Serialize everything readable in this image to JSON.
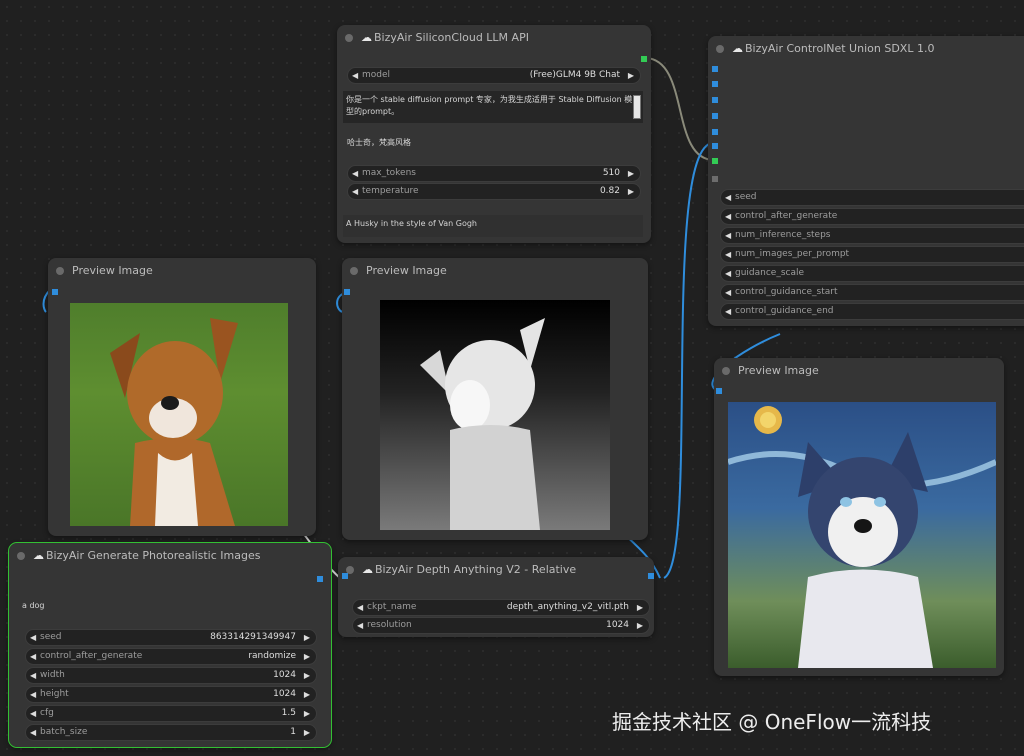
{
  "llm_node": {
    "title": "BizyAir SiliconCloud LLM API",
    "model_label": "model",
    "model_value": "(Free)GLM4 9B Chat",
    "system_prompt": "你是一个 stable diffusion prompt 专家，为我生成适用于 Stable Diffusion 模型的prompt。",
    "user_prompt": "哈士奇，梵高风格",
    "max_tokens_label": "max_tokens",
    "max_tokens_value": "510",
    "temperature_label": "temperature",
    "temperature_value": "0.82",
    "output_text": "A Husky in the style of Van Gogh"
  },
  "controlnet_node": {
    "title": "BizyAir ControlNet Union SDXL 1.0",
    "widgets": [
      "seed",
      "control_after_generate",
      "num_inference_steps",
      "num_images_per_prompt",
      "guidance_scale",
      "control_guidance_start",
      "control_guidance_end"
    ]
  },
  "preview1": {
    "title": "Preview Image"
  },
  "preview2": {
    "title": "Preview Image"
  },
  "preview3": {
    "title": "Preview Image"
  },
  "depth_node": {
    "title": "BizyAir Depth Anything V2 - Relative",
    "ckpt_label": "ckpt_name",
    "ckpt_value": "depth_anything_v2_vitl.pth",
    "resolution_label": "resolution",
    "resolution_value": "1024"
  },
  "generate_node": {
    "title": "BizyAir Generate Photorealistic Images",
    "prompt": "a dog",
    "seed_label": "seed",
    "seed_value": "863314291349947",
    "cag_label": "control_after_generate",
    "cag_value": "randomize",
    "width_label": "width",
    "width_value": "1024",
    "height_label": "height",
    "height_value": "1024",
    "cfg_label": "cfg",
    "cfg_value": "1.5",
    "batch_label": "batch_size",
    "batch_value": "1"
  },
  "watermark": "掘金技术社区 @ OneFlow一流科技",
  "colors": {
    "accent_blue": "#2f8ddc",
    "accent_green": "#33cc55",
    "node_bg": "#353535",
    "canvas_bg": "#202020"
  },
  "icons": {
    "cloud": "cloud-icon",
    "arrow_left": "arrow-left-icon",
    "arrow_right": "arrow-right-icon"
  }
}
